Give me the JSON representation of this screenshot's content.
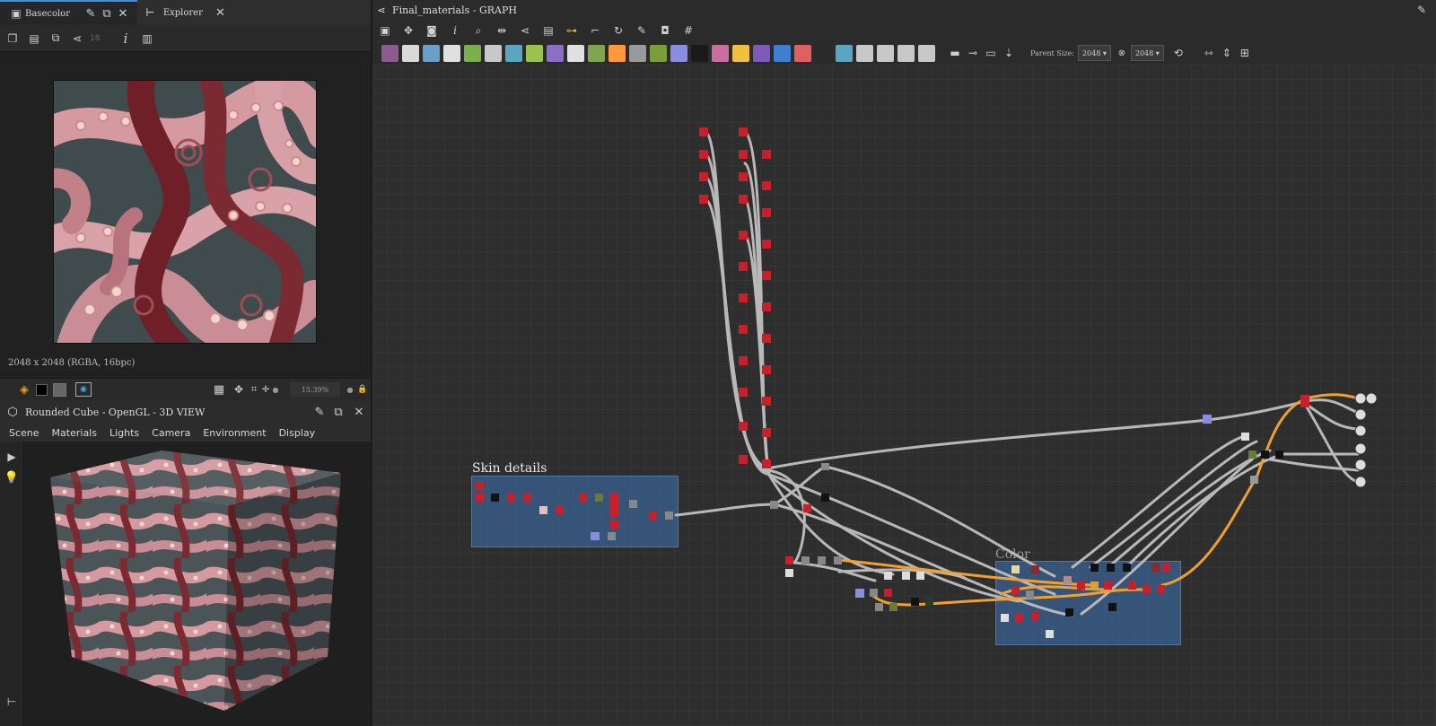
{
  "left_top": {
    "tabs": [
      {
        "label": "Basecolor",
        "active": true
      },
      {
        "label": "Explorer",
        "active": false
      }
    ],
    "toolbar_value": "18",
    "resolution_text": "2048 x 2048 (RGBA, 16bpc)",
    "zoom": "15.39%"
  },
  "view3d": {
    "title": "Rounded Cube - OpenGL - 3D VIEW",
    "menu": [
      "Scene",
      "Materials",
      "Lights",
      "Camera",
      "Environment",
      "Display"
    ]
  },
  "graph": {
    "title": "Final_materials - GRAPH",
    "parent_size_label": "Parent Size:",
    "size_w": "2048",
    "size_h": "2048",
    "frames": [
      {
        "label": "Skin details"
      },
      {
        "label": "Color"
      }
    ],
    "node_toolbar_colors": [
      "#8a5c8f",
      "#d9d9d9",
      "#6aa0c8",
      "#e0e0e0",
      "#7ab04a",
      "#c8c8c8",
      "#5aa6c0",
      "#9bc24e",
      "#8c6fc4",
      "#e0e0e0",
      "#7fa64f",
      "#ff9a3b",
      "#9a9a9a",
      "#7a9f3a",
      "#8a8ce0",
      "#1a1a1a",
      "#c86fa0",
      "#f0c040",
      "#7d5ab8",
      "#3d7fd0",
      "#e06060",
      "#2a2a2a",
      "#5aa6c0",
      "#c8c8c8",
      "#c8c8c8",
      "#c8c8c8",
      "#c8c8c8"
    ],
    "colors": {
      "accent": "#3d8fe0",
      "frame": "#3a6496",
      "wire": "#b8b8b8",
      "wire_highlight": "#f0a030",
      "node_red": "#c8202a"
    }
  }
}
